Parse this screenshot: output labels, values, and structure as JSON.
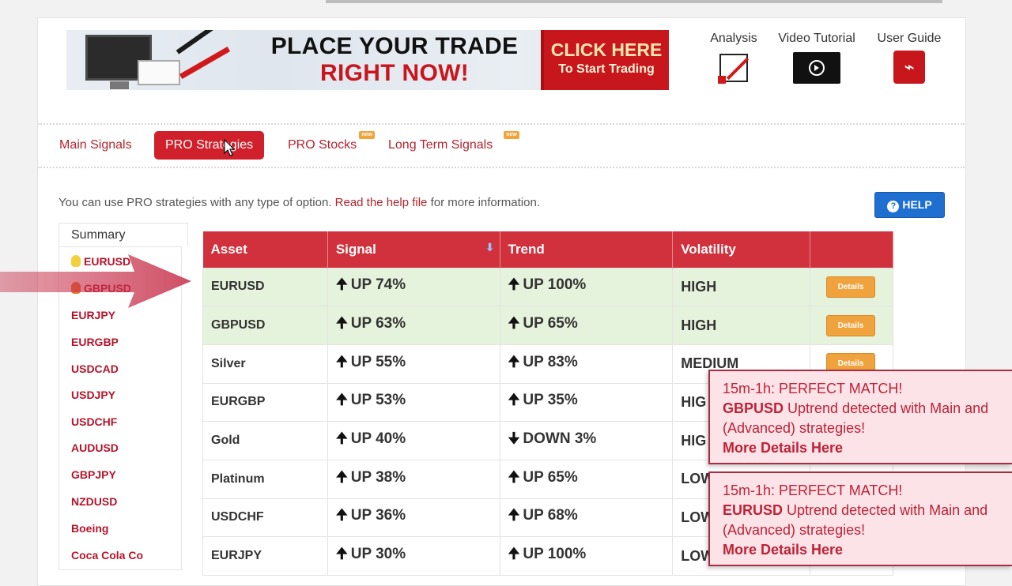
{
  "banner": {
    "headline_line1": "PLACE YOUR TRADE",
    "headline_line2": "RIGHT NOW!",
    "cta_line1": "CLICK HERE",
    "cta_line2": "To Start Trading"
  },
  "tools": {
    "analysis": "Analysis",
    "video": "Video Tutorial",
    "guide": "User Guide"
  },
  "tabs": {
    "main": "Main Signals",
    "pro_strategies": "PRO Strategies",
    "pro_stocks": "PRO Stocks",
    "long_term": "Long Term Signals",
    "new_badge": "new"
  },
  "info": {
    "before": "You can use PRO strategies with any type of option.",
    "link": "Read the help file",
    "after": "for more information."
  },
  "help_label": "HELP",
  "sidebar": {
    "summary": "Summary",
    "items": [
      "EURUSD",
      "GBPUSD",
      "EURJPY",
      "EURGBP",
      "USDCAD",
      "USDJPY",
      "USDCHF",
      "AUDUSD",
      "GBPJPY",
      "NZDUSD",
      "Boeing",
      "Coca Cola Co"
    ]
  },
  "table": {
    "headers": [
      "Asset",
      "Signal",
      "Trend",
      "Volatility",
      ""
    ],
    "details_label": "Details",
    "rows": [
      {
        "asset": "EURUSD",
        "signal": "UP 74%",
        "trend": "UP 100%",
        "vol": "HIGH"
      },
      {
        "asset": "GBPUSD",
        "signal": "UP 63%",
        "trend": "UP 65%",
        "vol": "HIGH"
      },
      {
        "asset": "Silver",
        "signal": "UP 55%",
        "trend": "UP 83%",
        "vol": "MEDIUM"
      },
      {
        "asset": "EURGBP",
        "signal": "UP 53%",
        "trend": "UP 35%",
        "vol": "HIG"
      },
      {
        "asset": "Gold",
        "signal": "UP 40%",
        "trend": "DOWN 3%",
        "vol": "HIG"
      },
      {
        "asset": "Platinum",
        "signal": "UP 38%",
        "trend": "UP 65%",
        "vol": "LOW"
      },
      {
        "asset": "USDCHF",
        "signal": "UP 36%",
        "trend": "UP 68%",
        "vol": "LOW"
      },
      {
        "asset": "EURJPY",
        "signal": "UP 30%",
        "trend": "UP 100%",
        "vol": "LOW"
      }
    ]
  },
  "popups": [
    {
      "title": "15m-1h: PERFECT MATCH!",
      "asset": "GBPUSD",
      "text1": "Uptrend detected with Main and",
      "text2": "(Advanced) strategies!",
      "more": "More Details Here"
    },
    {
      "title": "15m-1h: PERFECT MATCH!",
      "asset": "EURUSD",
      "text1": "Uptrend detected with Main and",
      "text2": "(Advanced) strategies!",
      "more": "More Details Here"
    }
  ],
  "colors": {
    "brand_red": "#d0202c",
    "up_green": "#2fbf2f",
    "mid_yellow": "#c9b51c",
    "neutral_gray": "#8a8a8a",
    "details_orange": "#f0a23d",
    "help_blue": "#1f6fd1"
  }
}
